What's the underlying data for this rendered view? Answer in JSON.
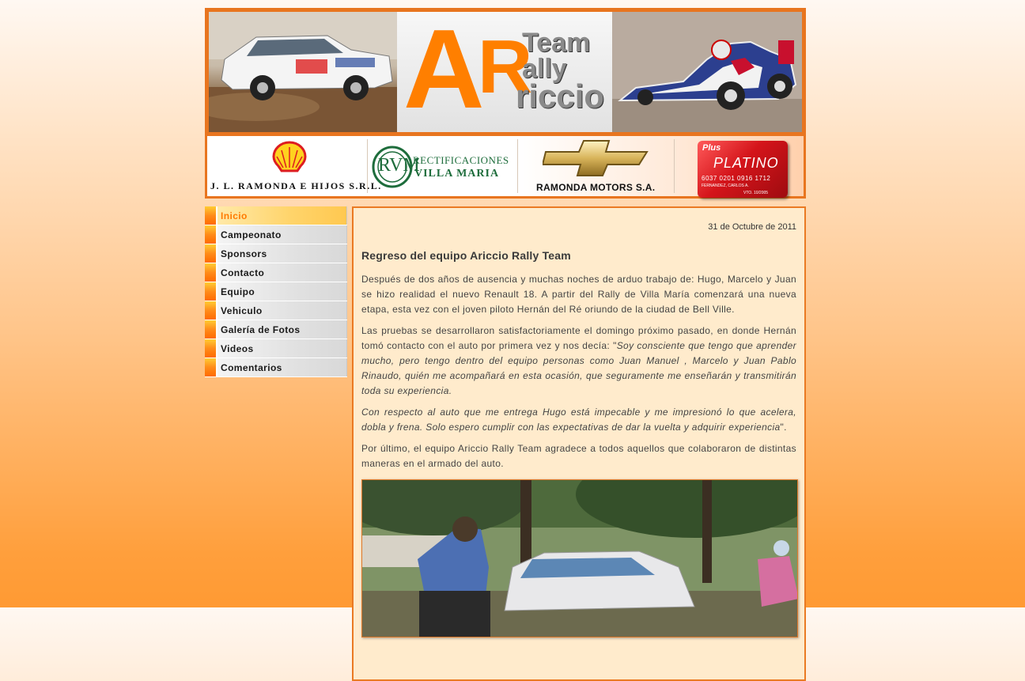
{
  "header": {
    "logo": {
      "big_a": "A",
      "big_r": "R",
      "team": "Team",
      "rally": "ally",
      "ariccio": "riccio"
    },
    "sponsors": {
      "shell": "J. L. RAMONDA E HIJOS S.R.L.",
      "rvm_initials": "RVM",
      "rvm_line1": "RECTIFICACIONES",
      "rvm_line2": "VILLA MARIA",
      "ramonda": "RAMONDA MOTORS S.A.",
      "platino_plus": "Plus",
      "platino_name": "PLATINO",
      "platino_number": "6037 0201 0916 1712",
      "platino_holder": "FERNANDEZ, CARLOS A.",
      "platino_vto": "VTO. 10/2005"
    }
  },
  "menu": {
    "items": [
      {
        "label": "Inicio",
        "active": true
      },
      {
        "label": "Campeonato",
        "active": false
      },
      {
        "label": "Sponsors",
        "active": false
      },
      {
        "label": "Contacto",
        "active": false
      },
      {
        "label": "Equipo",
        "active": false
      },
      {
        "label": "Vehiculo",
        "active": false
      },
      {
        "label": "Galería de Fotos",
        "active": false
      },
      {
        "label": "Videos",
        "active": false
      },
      {
        "label": "Comentarios",
        "active": false
      }
    ]
  },
  "post": {
    "date": "31 de Octubre de 2011",
    "title": "Regreso del equipo Ariccio Rally Team",
    "p1": "Después de dos años de ausencia y muchas noches de arduo trabajo de: Hugo, Marcelo y Juan se hizo realidad el nuevo Renault 18. A partir del Rally de Villa María comenzará una nueva etapa, esta vez con el joven piloto Hernán del Ré oriundo de la ciudad de Bell Ville.",
    "p2_plain": "Las pruebas se desarrollaron satisfactoriamente el domingo próximo pasado, en donde Hernán tomó contacto con el auto por primera vez y nos decía: \"",
    "p2_quote": "Soy consciente que tengo que aprender mucho, pero tengo dentro del equipo personas como Juan Manuel , Marcelo y Juan Pablo Rinaudo, quién me acompañará en esta ocasión, que seguramente me enseñarán y transmitirán toda su experiencia.",
    "p3_quote": "Con respecto al auto que me entrega Hugo está impecable y me impresionó lo que acelera, dobla y frena. Solo espero cumplir con las expectativas de dar la vuelta y adquirir experiencia",
    "p3_end": "\".",
    "p4": "Por último, el equipo Ariccio Rally Team agradece a todos aquellos que colaboraron de distintas maneras en el armado del auto."
  },
  "colors": {
    "accent_orange": "#ff7f00",
    "border_orange": "#ea7a23",
    "content_bg": "#ffebcc"
  }
}
